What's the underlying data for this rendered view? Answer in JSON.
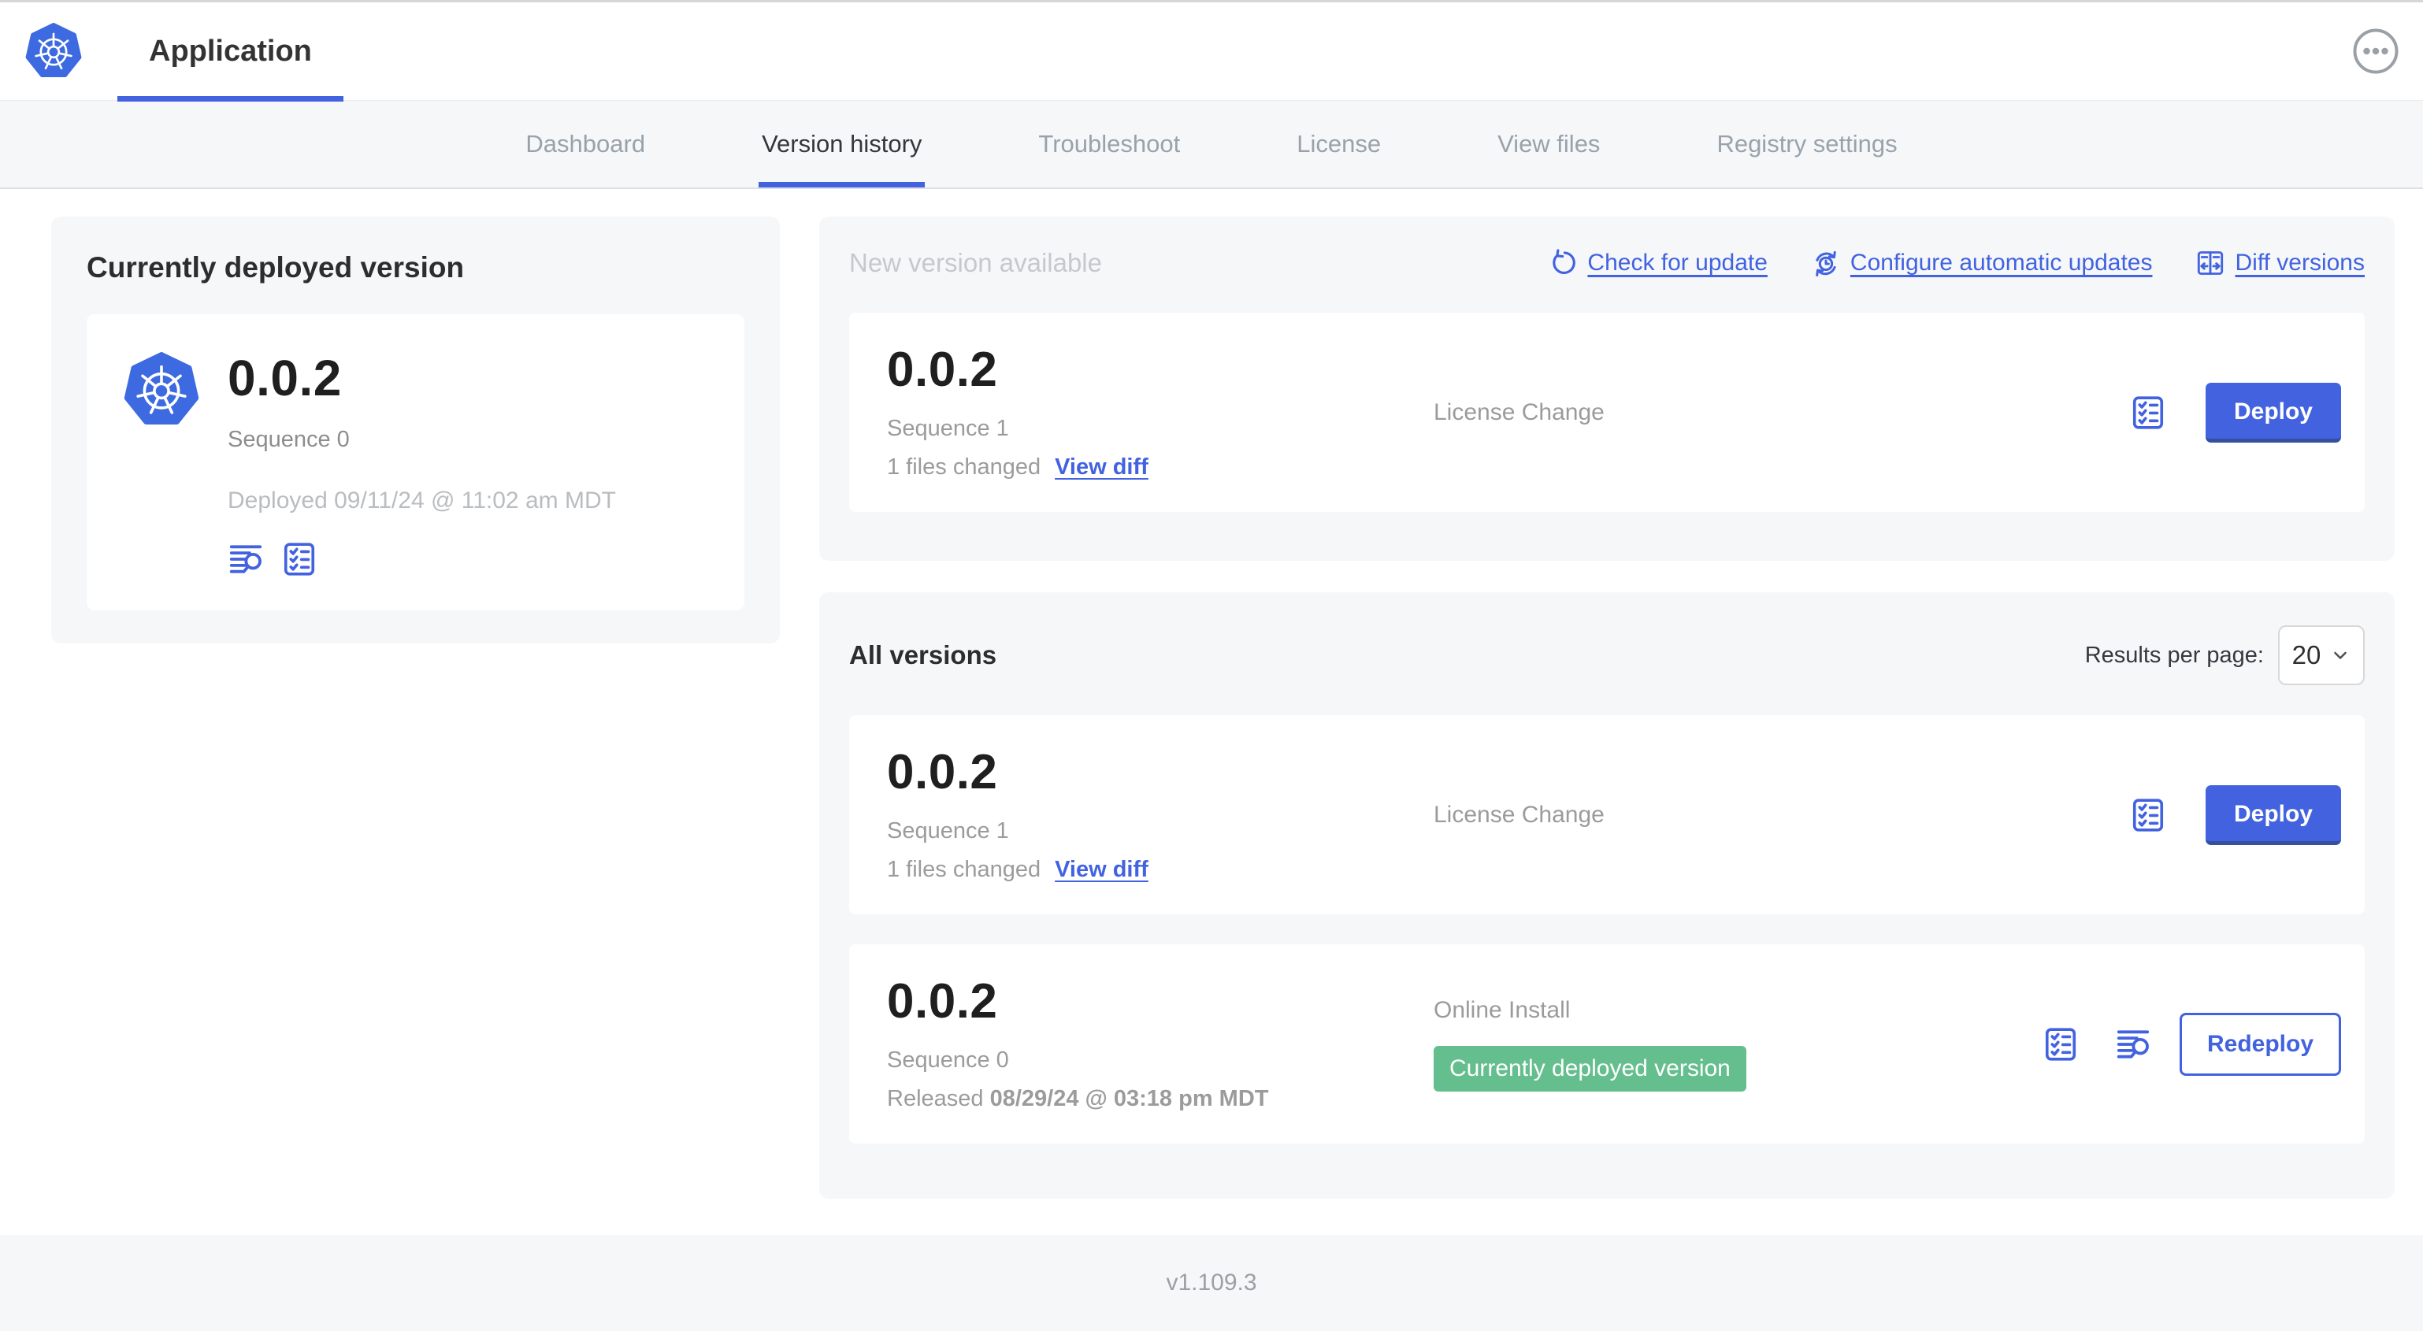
{
  "header": {
    "app_title": "Application"
  },
  "nav": {
    "tabs": [
      {
        "label": "Dashboard"
      },
      {
        "label": "Version history"
      },
      {
        "label": "Troubleshoot"
      },
      {
        "label": "License"
      },
      {
        "label": "View files"
      },
      {
        "label": "Registry settings"
      }
    ],
    "active_tab": "Version history"
  },
  "current_version_panel": {
    "title": "Currently deployed version",
    "version": "0.0.2",
    "sequence": "Sequence 0",
    "deployed": "Deployed 09/11/24 @ 11:02 am MDT"
  },
  "new_version_panel": {
    "title": "New version available",
    "actions": {
      "check_for_update": "Check for update",
      "configure_automatic_updates": "Configure automatic updates",
      "diff_versions": "Diff versions"
    },
    "row": {
      "version": "0.0.2",
      "sequence": "Sequence 1",
      "files_changed": "1 files changed",
      "view_diff": "View diff",
      "source": "License Change",
      "deploy": "Deploy"
    }
  },
  "all_versions_panel": {
    "title": "All versions",
    "results_per_page_label": "Results per page:",
    "results_per_page_value": "20",
    "rows": [
      {
        "version": "0.0.2",
        "sequence": "Sequence 1",
        "files_changed": "1 files changed",
        "view_diff": "View diff",
        "source": "License Change",
        "action": "Deploy"
      },
      {
        "version": "0.0.2",
        "sequence": "Sequence 0",
        "released_prefix": "Released ",
        "released_date": "08/29/24 @ 03:18 pm MDT",
        "source": "Online Install",
        "badge": "Currently deployed version",
        "action": "Redeploy"
      }
    ]
  },
  "footer": {
    "app_version": "v1.109.3"
  },
  "colors": {
    "accent": "#4262e0",
    "badge_green": "#65be8e",
    "logo_blue": "#3e6ae1"
  }
}
